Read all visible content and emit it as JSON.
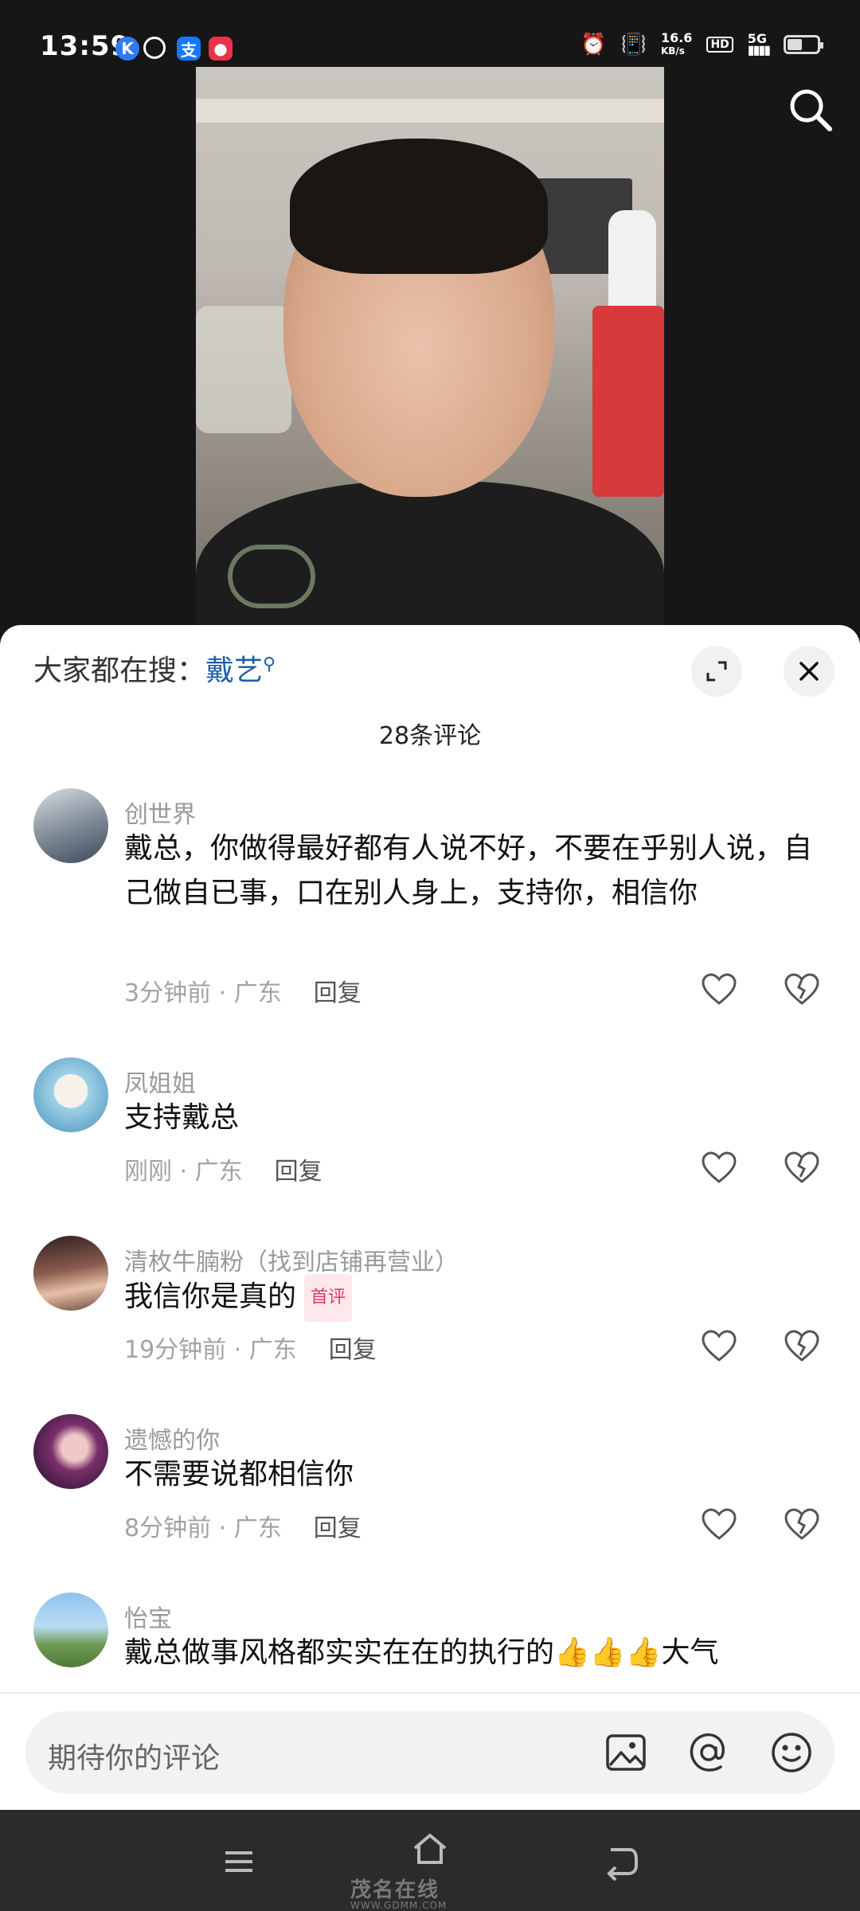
{
  "status_bar": {
    "time": "13:59",
    "network_speed": "16.6",
    "network_unit": "KB/s",
    "hd": "HD",
    "network_type": "5G"
  },
  "panel": {
    "search_prefix": "大家都在搜：",
    "search_keyword": "戴艺",
    "comment_count": "28条评论"
  },
  "comments": [
    {
      "user": "创世界",
      "text": "戴总，你做得最好都有人说不好，不要在乎别人说，自己做自已事，口在别人身上，支持你，相信你",
      "meta": "3分钟前 · 广东",
      "reply": "回复"
    },
    {
      "user": "凤姐姐",
      "text": "支持戴总",
      "meta": "刚刚 · 广东",
      "reply": "回复"
    },
    {
      "user": "清枚牛腩粉（找到店铺再营业）",
      "text": "我信你是真的",
      "tag": "首评",
      "meta": "19分钟前 · 广东",
      "reply": "回复"
    },
    {
      "user": "遗憾的你",
      "text": "不需要说都相信你",
      "meta": "8分钟前 · 广东",
      "reply": "回复"
    },
    {
      "user": "怡宝",
      "text": "戴总做事风格都实实在在的执行的👍👍👍大气"
    }
  ],
  "input": {
    "placeholder": "期待你的评论"
  },
  "watermark": {
    "name": "茂名在线",
    "url": "WWW.GDMM.COM"
  },
  "icons": [
    "search-icon",
    "expand-icon",
    "close-icon",
    "heart-icon",
    "broken-heart-icon",
    "image-icon",
    "at-icon",
    "emoji-icon",
    "menu-icon",
    "home-icon",
    "back-icon"
  ]
}
